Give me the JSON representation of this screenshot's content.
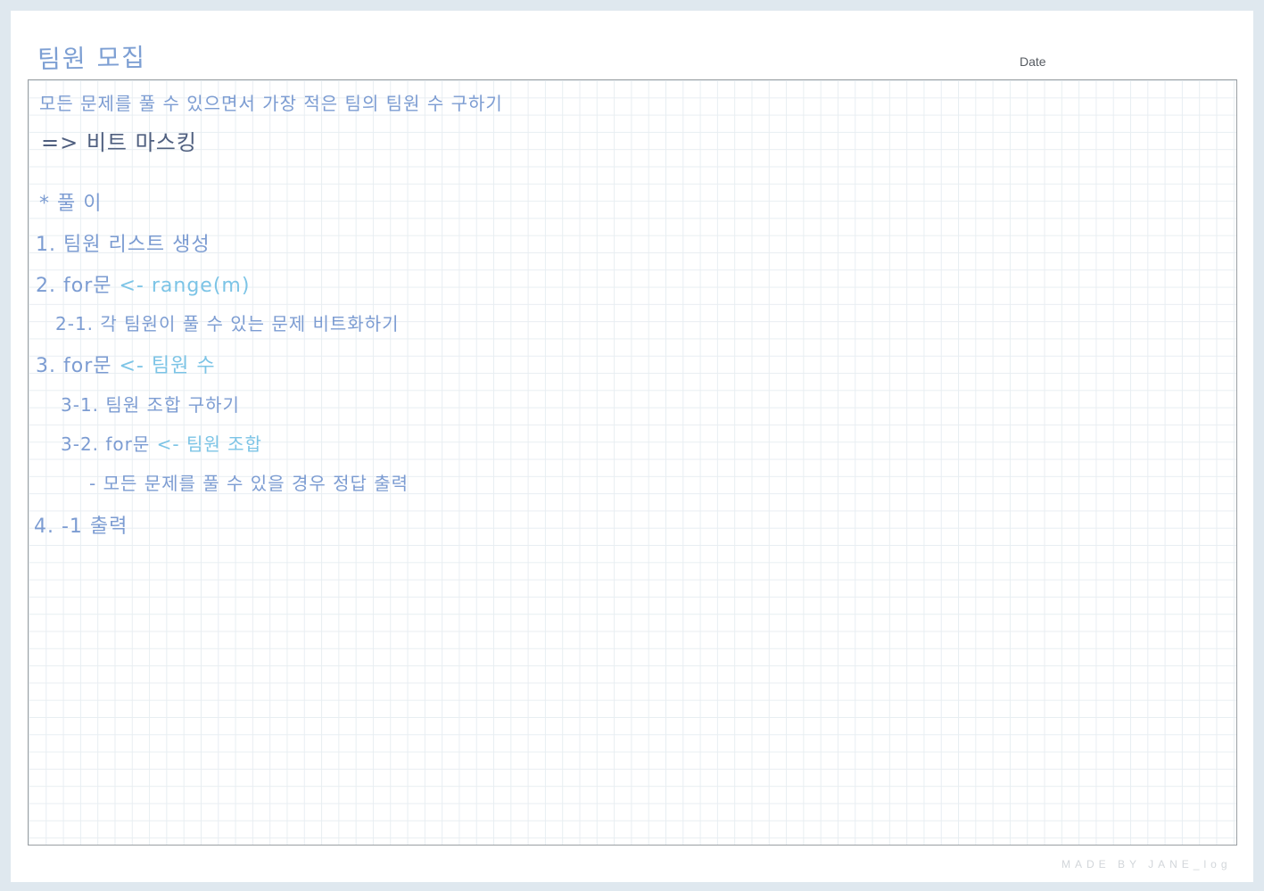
{
  "page": {
    "title": "팀원 모집",
    "date_label": "Date",
    "footer": "MADE BY JANE_log"
  },
  "notes": {
    "problem": "모든 문제를 풀 수 있으면서 가장 적은 팀의 팀원 수 구하기",
    "method": "=> 비트 마스킹",
    "solution_header": "* 풀 이",
    "step1": "1. 팀원 리스트 생성",
    "step2_prefix": "2. for문",
    "step2_arrow": "<- range(m)",
    "step2_1": "2-1. 각 팀원이 풀 수 있는 문제 비트화하기",
    "step3_prefix": "3. for문",
    "step3_arrow": "<- 팀원 수",
    "step3_1": "3-1. 팀원 조합 구하기",
    "step3_2_prefix": "3-2. for문",
    "step3_2_arrow": "<- 팀원 조합",
    "step3_2_detail": "- 모든 문제를 풀 수 있을 경우 정답 출력",
    "step4": "4. -1 출력"
  },
  "colors": {
    "ink_blue": "#7c9cd2",
    "ink_light_blue": "#7cc4e6",
    "ink_dark": "#4f5f7f",
    "grid_line": "#e8eef2",
    "background": "#dfe8ef"
  }
}
